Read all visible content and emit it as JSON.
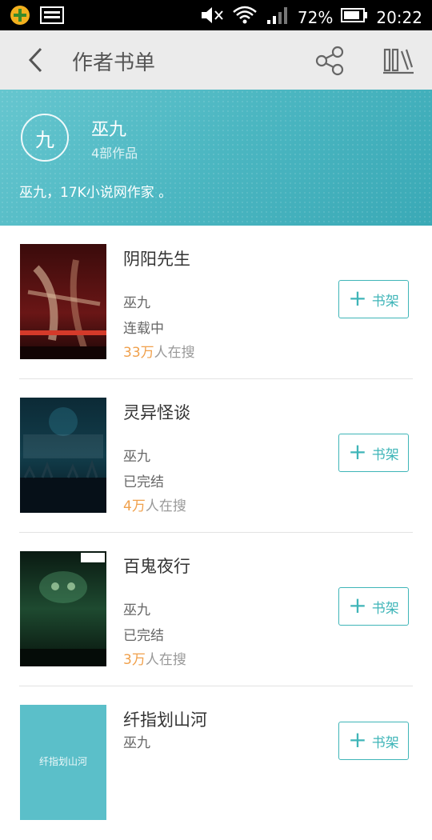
{
  "status_bar": {
    "battery_percent": "72%",
    "time": "20:22"
  },
  "header": {
    "title": "作者书单",
    "back_icon": "back-arrow-icon",
    "share_icon": "share-icon",
    "shelf_icon": "bookshelf-icon"
  },
  "author": {
    "avatar_char": "九",
    "name": "巫九",
    "works": "4部作品",
    "description": "巫九，17K小说网作家 。",
    "banner_color": "#4bb6c1"
  },
  "add_button_label": "书架",
  "accent_color": "#3fb5b8",
  "highlight_color": "#f0a04b",
  "books": [
    {
      "title": "阴阳先生",
      "author": "巫九",
      "status": "连载中",
      "search_count": "33万",
      "search_suffix": "人在搜"
    },
    {
      "title": "灵异怪谈",
      "author": "巫九",
      "status": "已完结",
      "search_count": "4万",
      "search_suffix": "人在搜"
    },
    {
      "title": "百鬼夜行",
      "author": "巫九",
      "status": "已完结",
      "search_count": "3万",
      "search_suffix": "人在搜"
    },
    {
      "title": "纤指划山河",
      "author": "巫九",
      "cover_text": "纤指划山河"
    }
  ]
}
